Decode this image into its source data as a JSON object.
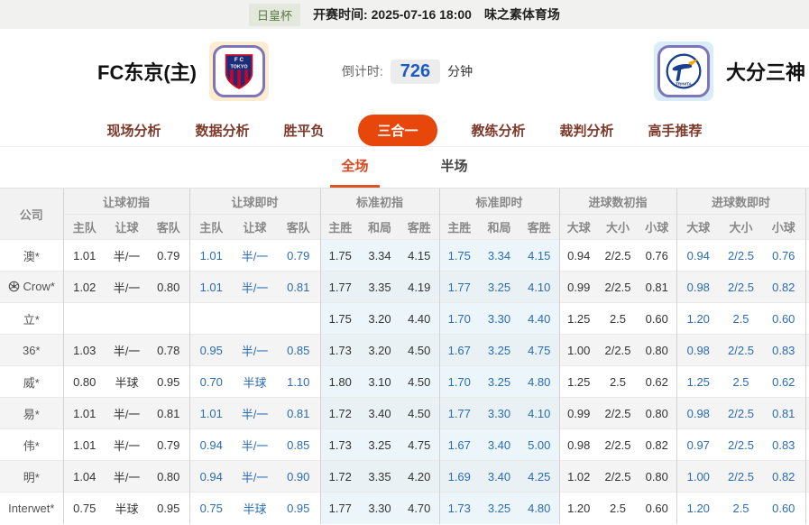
{
  "colors": {
    "accent_orange": "#e8470b",
    "sub_tab_red": "#d9481f",
    "live_odds_blue": "#2b6cb5",
    "countdown_blue": "#1a5bc4",
    "standard_col_azure": "#ecf6fa",
    "home_badge_bg": "#fcedd0",
    "away_badge_bg": "#d9ecfa",
    "league_badge_bg": "#e3e7dc"
  },
  "top_bar": {
    "league": "日皇杯",
    "kickoff_label": "开赛时间:",
    "kickoff_time": "2025-07-16 18:00",
    "venue": "味之素体育场"
  },
  "match_header": {
    "home_team": "FC东京(主)",
    "away_team": "大分三神",
    "countdown_label": "倒计时:",
    "countdown_value": "726",
    "countdown_unit": "分钟"
  },
  "nav_tabs": [
    {
      "id": "live-analysis",
      "label": "现场分析",
      "active": false
    },
    {
      "id": "data-analysis",
      "label": "数据分析",
      "active": false
    },
    {
      "id": "win-draw-lose",
      "label": "胜平负",
      "active": false
    },
    {
      "id": "three-in-one",
      "label": "三合一",
      "active": true
    },
    {
      "id": "coach-analysis",
      "label": "教练分析",
      "active": false
    },
    {
      "id": "referee-analysis",
      "label": "裁判分析",
      "active": false
    },
    {
      "id": "expert-picks",
      "label": "高手推荐",
      "active": false
    }
  ],
  "sub_tabs": [
    {
      "id": "full-match",
      "label": "全场",
      "active": true
    },
    {
      "id": "half-match",
      "label": "半场",
      "active": false
    }
  ],
  "table": {
    "corner_header": "公司",
    "groups": [
      "让球初指",
      "让球即时",
      "标准初指",
      "标准即时",
      "进球数初指",
      "进球数即时"
    ],
    "sub_headers": [
      "主队",
      "让球",
      "客队",
      "主队",
      "让球",
      "客队",
      "主胜",
      "和局",
      "客胜",
      "主胜",
      "和局",
      "客胜",
      "大球",
      "大小",
      "小球",
      "大球",
      "大小",
      "小球"
    ],
    "rows": [
      {
        "company": "澳*",
        "values": [
          "1.01",
          "半/一",
          "0.79",
          "1.01",
          "半/一",
          "0.79",
          "1.75",
          "3.34",
          "4.15",
          "1.75",
          "3.34",
          "4.15",
          "0.94",
          "2/2.5",
          "0.76",
          "0.94",
          "2/2.5",
          "0.76"
        ]
      },
      {
        "company": "Crow*",
        "icon": "soccer-ball-icon",
        "values": [
          "1.02",
          "半/一",
          "0.80",
          "1.01",
          "半/一",
          "0.81",
          "1.77",
          "3.35",
          "4.19",
          "1.77",
          "3.25",
          "4.10",
          "0.99",
          "2/2.5",
          "0.81",
          "0.98",
          "2/2.5",
          "0.82"
        ]
      },
      {
        "company": "立*",
        "values": [
          "",
          "",
          "",
          "",
          "",
          "",
          "1.75",
          "3.20",
          "4.40",
          "1.70",
          "3.30",
          "4.40",
          "1.25",
          "2.5",
          "0.60",
          "1.20",
          "2.5",
          "0.60"
        ]
      },
      {
        "company": "36*",
        "values": [
          "1.03",
          "半/一",
          "0.78",
          "0.95",
          "半/一",
          "0.85",
          "1.73",
          "3.20",
          "4.50",
          "1.67",
          "3.25",
          "4.75",
          "1.00",
          "2/2.5",
          "0.80",
          "0.98",
          "2/2.5",
          "0.83"
        ]
      },
      {
        "company": "威*",
        "values": [
          "0.80",
          "半球",
          "0.95",
          "0.70",
          "半球",
          "1.10",
          "1.80",
          "3.10",
          "4.50",
          "1.70",
          "3.25",
          "4.80",
          "1.25",
          "2.5",
          "0.62",
          "1.25",
          "2.5",
          "0.62"
        ]
      },
      {
        "company": "易*",
        "values": [
          "1.01",
          "半/一",
          "0.81",
          "1.01",
          "半/一",
          "0.81",
          "1.72",
          "3.40",
          "4.50",
          "1.77",
          "3.30",
          "4.10",
          "0.99",
          "2/2.5",
          "0.80",
          "0.98",
          "2/2.5",
          "0.81"
        ]
      },
      {
        "company": "伟*",
        "values": [
          "1.01",
          "半/一",
          "0.79",
          "0.94",
          "半/一",
          "0.85",
          "1.73",
          "3.25",
          "4.75",
          "1.67",
          "3.40",
          "5.00",
          "0.98",
          "2/2.5",
          "0.82",
          "0.97",
          "2/2.5",
          "0.83"
        ]
      },
      {
        "company": "明*",
        "values": [
          "1.04",
          "半/一",
          "0.80",
          "0.94",
          "半/一",
          "0.90",
          "1.72",
          "3.35",
          "4.20",
          "1.69",
          "3.40",
          "4.25",
          "1.02",
          "2/2.5",
          "0.80",
          "1.00",
          "2/2.5",
          "0.82"
        ]
      },
      {
        "company": "Interwet*",
        "values": [
          "0.75",
          "半球",
          "0.95",
          "0.75",
          "半球",
          "0.95",
          "1.77",
          "3.30",
          "4.70",
          "1.73",
          "3.25",
          "4.80",
          "1.20",
          "2.5",
          "0.60",
          "1.20",
          "2.5",
          "0.60"
        ]
      }
    ]
  }
}
